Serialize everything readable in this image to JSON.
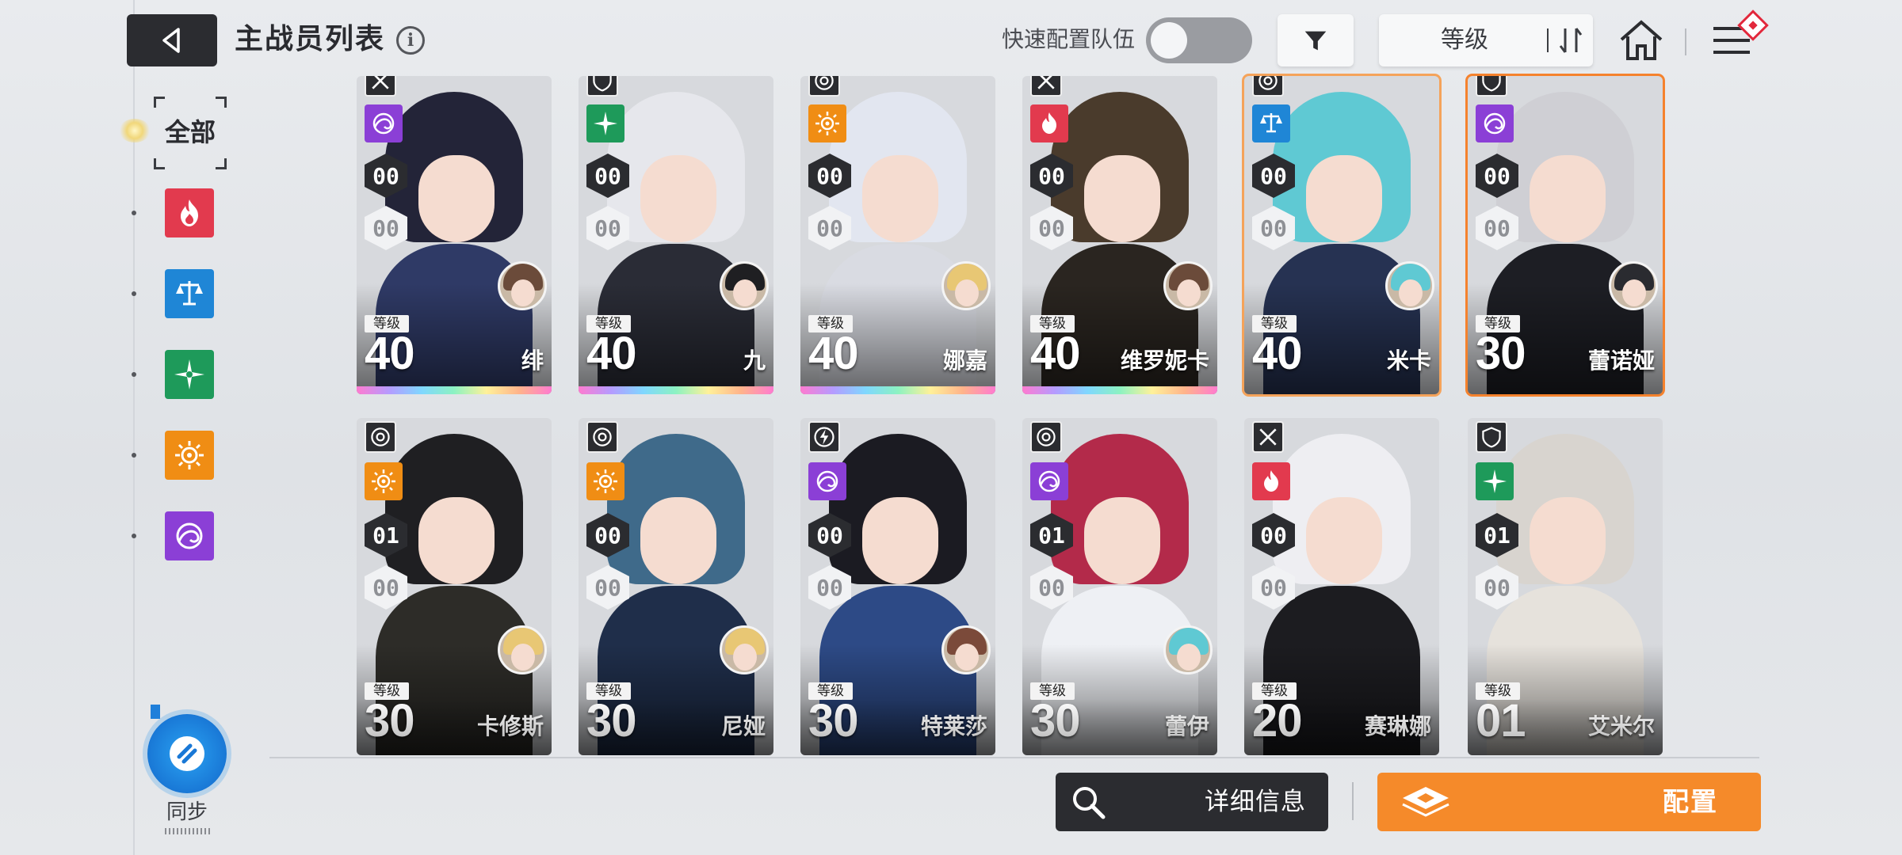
{
  "header": {
    "title": "主战员列表",
    "info_glyph": "i",
    "quick_config_label": "快速配置队伍",
    "quick_config_on": false,
    "sort_label": "等级"
  },
  "filters": {
    "all_label": "全部",
    "items": [
      {
        "name": "fire",
        "color": "#e23a4e",
        "icon": "flame-icon"
      },
      {
        "name": "balance",
        "color": "#1f86d6",
        "icon": "scales-icon"
      },
      {
        "name": "wind",
        "color": "#1e9a5a",
        "icon": "compass-star-icon"
      },
      {
        "name": "electric",
        "color": "#f08d14",
        "icon": "sun-gear-icon"
      },
      {
        "name": "void",
        "color": "#8b3fd6",
        "icon": "spiral-icon"
      }
    ]
  },
  "sync": {
    "label": "同步"
  },
  "level_tag": "等级",
  "cards": [
    {
      "name": "绯",
      "level": "40",
      "rank1": "00",
      "rank2": "00",
      "element_color": "#8b3fd6",
      "class_icon": "swords-icon",
      "hair": "#232438",
      "body": "#2f3a66",
      "support_hair": "#6b4b3a",
      "row": 1,
      "rainbow": true
    },
    {
      "name": "九",
      "level": "40",
      "rank1": "00",
      "rank2": "00",
      "element_color": "#1e9a5a",
      "class_icon": "shield-icon",
      "hair": "#e6e7ec",
      "body": "#2a2c36",
      "support_hair": "#1f1f22",
      "row": 1,
      "rainbow": true
    },
    {
      "name": "娜嘉",
      "level": "40",
      "rank1": "00",
      "rank2": "00",
      "element_color": "#f08d14",
      "class_icon": "target-icon",
      "hair": "#e2e6f0",
      "body": "#d9dbe2",
      "support_hair": "#e8c774",
      "row": 1,
      "rainbow": true
    },
    {
      "name": "维罗妮卡",
      "level": "40",
      "rank1": "00",
      "rank2": "00",
      "element_color": "#e23a4e",
      "class_icon": "swords-icon",
      "hair": "#4a3b2c",
      "body": "#2a2520",
      "support_hair": "#6b4b3a",
      "row": 1,
      "rainbow": true
    },
    {
      "name": "米卡",
      "level": "40",
      "rank1": "00",
      "rank2": "00",
      "element_color": "#1f86d6",
      "class_icon": "target-icon",
      "hair": "#5fc9d3",
      "body": "#263252",
      "support_hair": "#5fc9d3",
      "row": 1,
      "rainbow": false,
      "selected": "soft"
    },
    {
      "name": "蕾诺娅",
      "level": "30",
      "rank1": "00",
      "rank2": "00",
      "element_color": "#8b3fd6",
      "class_icon": "shield-icon",
      "hair": "#cfcfd4",
      "body": "#1d1e24",
      "support_hair": "#2a2b30",
      "row": 1,
      "rainbow": false,
      "selected": "strong"
    },
    {
      "name": "卡修斯",
      "level": "30",
      "rank1": "01",
      "rank2": "00",
      "element_color": "#f08d14",
      "class_icon": "target-icon",
      "hair": "#1f1f22",
      "body": "#2d2c28",
      "support_hair": "#e8c774",
      "row": 2
    },
    {
      "name": "尼娅",
      "level": "30",
      "rank1": "00",
      "rank2": "00",
      "element_color": "#f08d14",
      "class_icon": "target-icon",
      "hair": "#3f6a8a",
      "body": "#1f2e4a",
      "support_hair": "#e8c774",
      "row": 2
    },
    {
      "name": "特莱莎",
      "level": "30",
      "rank1": "00",
      "rank2": "00",
      "element_color": "#8b3fd6",
      "class_icon": "bolt-icon",
      "hair": "#1b1b22",
      "body": "#2d4a86",
      "support_hair": "#7b4a3a",
      "row": 2
    },
    {
      "name": "蕾伊",
      "level": "30",
      "rank1": "01",
      "rank2": "00",
      "element_color": "#8b3fd6",
      "class_icon": "target-icon",
      "hair": "#b32a4a",
      "body": "#eef0f4",
      "support_hair": "#5fc9d3",
      "row": 2
    },
    {
      "name": "赛琳娜",
      "level": "20",
      "rank1": "00",
      "rank2": "00",
      "element_color": "#e23a4e",
      "class_icon": "swords-icon",
      "hair": "#eeeef2",
      "body": "#1c1c20",
      "support_hair": "",
      "row": 2
    },
    {
      "name": "艾米尔",
      "level": "01",
      "rank1": "01",
      "rank2": "00",
      "element_color": "#1e9a5a",
      "class_icon": "shield-icon",
      "hair": "#d8d4cf",
      "body": "#e6e2dc",
      "support_hair": "",
      "row": 2
    }
  ],
  "buttons": {
    "detail_label": "详细信息",
    "config_label": "配置"
  }
}
